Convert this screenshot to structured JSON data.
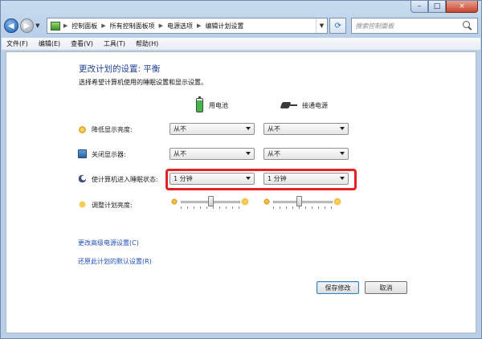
{
  "window": {
    "minimize": "–",
    "maximize": "□",
    "close": "×"
  },
  "address": {
    "crumbs": [
      "控制面板",
      "所有控制面板项",
      "电源选项",
      "编辑计划设置"
    ]
  },
  "search": {
    "placeholder": "搜索控制面板"
  },
  "menu": [
    "文件(F)",
    "编辑(E)",
    "查看(V)",
    "工具(T)",
    "帮助(H)"
  ],
  "page": {
    "title": "更改计划的设置: 平衡",
    "subtitle": "选择希望计算机使用的睡眠设置和显示设置。"
  },
  "columns": {
    "battery": "用电池",
    "plugged": "接通电源"
  },
  "rows": [
    {
      "label": "降低显示亮度:",
      "battery": "从不",
      "plugged": "从不",
      "icon": "dim-display-icon"
    },
    {
      "label": "关闭显示器:",
      "battery": "从不",
      "plugged": "从不",
      "icon": "monitor-icon"
    },
    {
      "label": "使计算机进入睡眠状态:",
      "battery": "1 分钟",
      "plugged": "1 分钟",
      "icon": "sleep-icon"
    }
  ],
  "brightness": {
    "label": "调整计划亮度:",
    "battery_level": 0.5,
    "plugged_level": 0.44
  },
  "links": {
    "advanced": "更改高级电源设置(C)",
    "restore": "还原此计划的默认设置(R)"
  },
  "buttons": {
    "save": "保存修改",
    "cancel": "取消"
  },
  "colors": {
    "highlight": "#e52222",
    "title": "#1e3f95",
    "link": "#1f4fb5"
  }
}
